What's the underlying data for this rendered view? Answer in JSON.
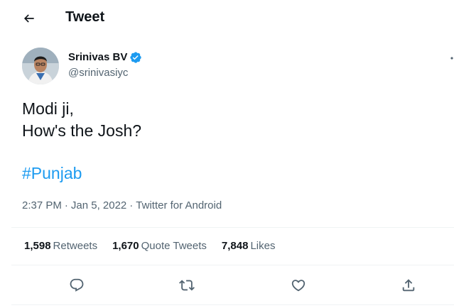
{
  "header": {
    "back_icon": "arrow-left-icon",
    "title": "Tweet"
  },
  "author": {
    "name": "Srinivas BV",
    "handle": "@srinivasiyc",
    "verified_icon": "verified-badge-icon",
    "verified_color": "#1d9bf0"
  },
  "tweet": {
    "lines": [
      "Modi ji,",
      "How's the Josh?"
    ],
    "hashtag": "#Punjab",
    "time": "2:37 PM",
    "date": "Jan 5, 2022",
    "separator": "·",
    "source": "Twitter for Android"
  },
  "stats": [
    {
      "count": "1,598",
      "label": "Retweets"
    },
    {
      "count": "1,670",
      "label": "Quote Tweets"
    },
    {
      "count": "7,848",
      "label": "Likes"
    }
  ],
  "actions": [
    {
      "icon": "reply-icon"
    },
    {
      "icon": "retweet-icon"
    },
    {
      "icon": "like-heart-icon"
    },
    {
      "icon": "share-icon"
    }
  ],
  "colors": {
    "accent": "#1d9bf0",
    "text_primary": "#0f1419",
    "text_secondary": "#536471",
    "divider": "#eff3f4"
  }
}
